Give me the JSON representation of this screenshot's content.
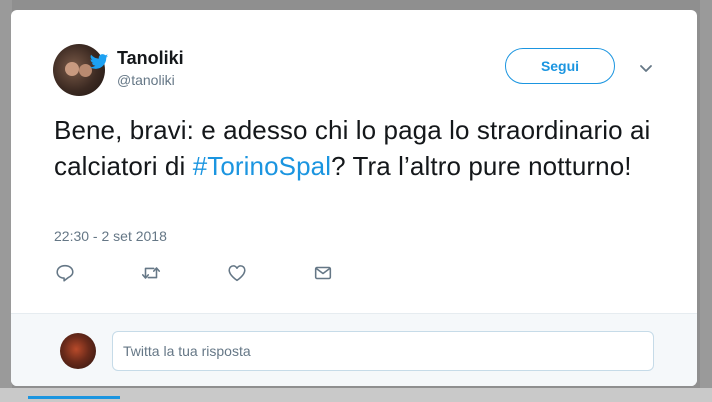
{
  "tweet": {
    "author_name": "Tanoliki",
    "author_handle": "@tanoliki",
    "follow_label": "Segui",
    "text_before": "Bene, bravi: e adesso chi lo paga lo straordinario ai calciatori di ",
    "hashtag": "#TorinoSpal",
    "text_after": "? Tra l’altro pure notturno!",
    "timestamp": "22:30 - 2 set 2018"
  },
  "reply": {
    "placeholder": "Twitta la tua risposta"
  },
  "icons": {
    "bird_badge": "twitter-bird-icon",
    "caret": "chevron-down-icon",
    "reply": "reply-icon",
    "retweet": "retweet-icon",
    "like": "heart-icon",
    "dm": "envelope-icon"
  },
  "colors": {
    "accent": "#1b95e0",
    "text": "#14171a",
    "muted": "#657786"
  }
}
